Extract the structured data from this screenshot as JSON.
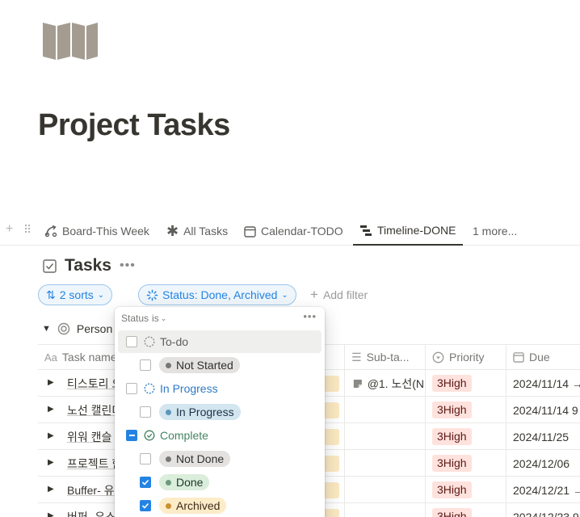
{
  "page": {
    "title": "Project Tasks"
  },
  "views": [
    {
      "label": "Board-This Week",
      "icon": "board-icon"
    },
    {
      "label": "All Tasks",
      "icon": "asterisk-icon"
    },
    {
      "label": "Calendar-TODO",
      "icon": "calendar-icon"
    },
    {
      "label": "Timeline-DONE",
      "icon": "timeline-icon",
      "active": true
    },
    {
      "label": "1 more..."
    }
  ],
  "database": {
    "title": "Tasks",
    "more": "•••"
  },
  "toolbar": {
    "sorts_label": "2 sorts",
    "status_filter_label": "Status: Done, Archived",
    "add_filter_label": "Add filter"
  },
  "group": {
    "label": "Person"
  },
  "columns": [
    {
      "label": "Task name",
      "icon": "Aa"
    },
    {
      "label": "Sub-ta...",
      "icon": "relation-icon"
    },
    {
      "label": "Priority",
      "icon": "select-icon"
    },
    {
      "label": "Due",
      "icon": "calendar-icon"
    }
  ],
  "rows": [
    {
      "name": "티스토리 오",
      "subtask": "@1. 노선(N",
      "priority": "3High",
      "due": "2024/11/14 →"
    },
    {
      "name": "노선 캘린더",
      "subtask": "",
      "priority": "3High",
      "due": "2024/11/14 9"
    },
    {
      "name": "위워 캔슬",
      "subtask": "",
      "priority": "3High",
      "due": "2024/11/25"
    },
    {
      "name": "프로젝트 한",
      "subtask": "",
      "priority": "3High",
      "due": "2024/12/06"
    },
    {
      "name": "Buffer- 유",
      "subtask": "",
      "priority": "3High",
      "due": "2024/12/21 →"
    },
    {
      "name": "버퍼- 유스",
      "subtask": "",
      "priority": "3High",
      "due": "2024/12/23 9"
    }
  ],
  "filter_menu": {
    "header_prop": "Status",
    "header_op": "is",
    "more": "•••",
    "groups": [
      {
        "label": "To-do",
        "color": "#5f5e5b",
        "state": "unchecked",
        "options": [
          {
            "label": "Not Started",
            "checked": false,
            "dot": "#787774",
            "bg": "#e3e2e0",
            "fg": "#32302c"
          }
        ]
      },
      {
        "label": "In Progress",
        "color": "#2e7bc4",
        "state": "unchecked",
        "options": [
          {
            "label": "In Progress",
            "checked": false,
            "dot": "#5b97bd",
            "bg": "#d3e5ef",
            "fg": "#183347"
          }
        ]
      },
      {
        "label": "Complete",
        "color": "#448361",
        "state": "partial",
        "options": [
          {
            "label": "Not Done",
            "checked": false,
            "dot": "#787774",
            "bg": "#e3e2e0",
            "fg": "#32302c"
          },
          {
            "label": "Done",
            "checked": true,
            "dot": "#6c9b7d",
            "bg": "#dbeddb",
            "fg": "#1c3829"
          },
          {
            "label": "Archived",
            "checked": true,
            "dot": "#cb912f",
            "bg": "#fdecc8",
            "fg": "#402c1b"
          }
        ]
      }
    ]
  }
}
